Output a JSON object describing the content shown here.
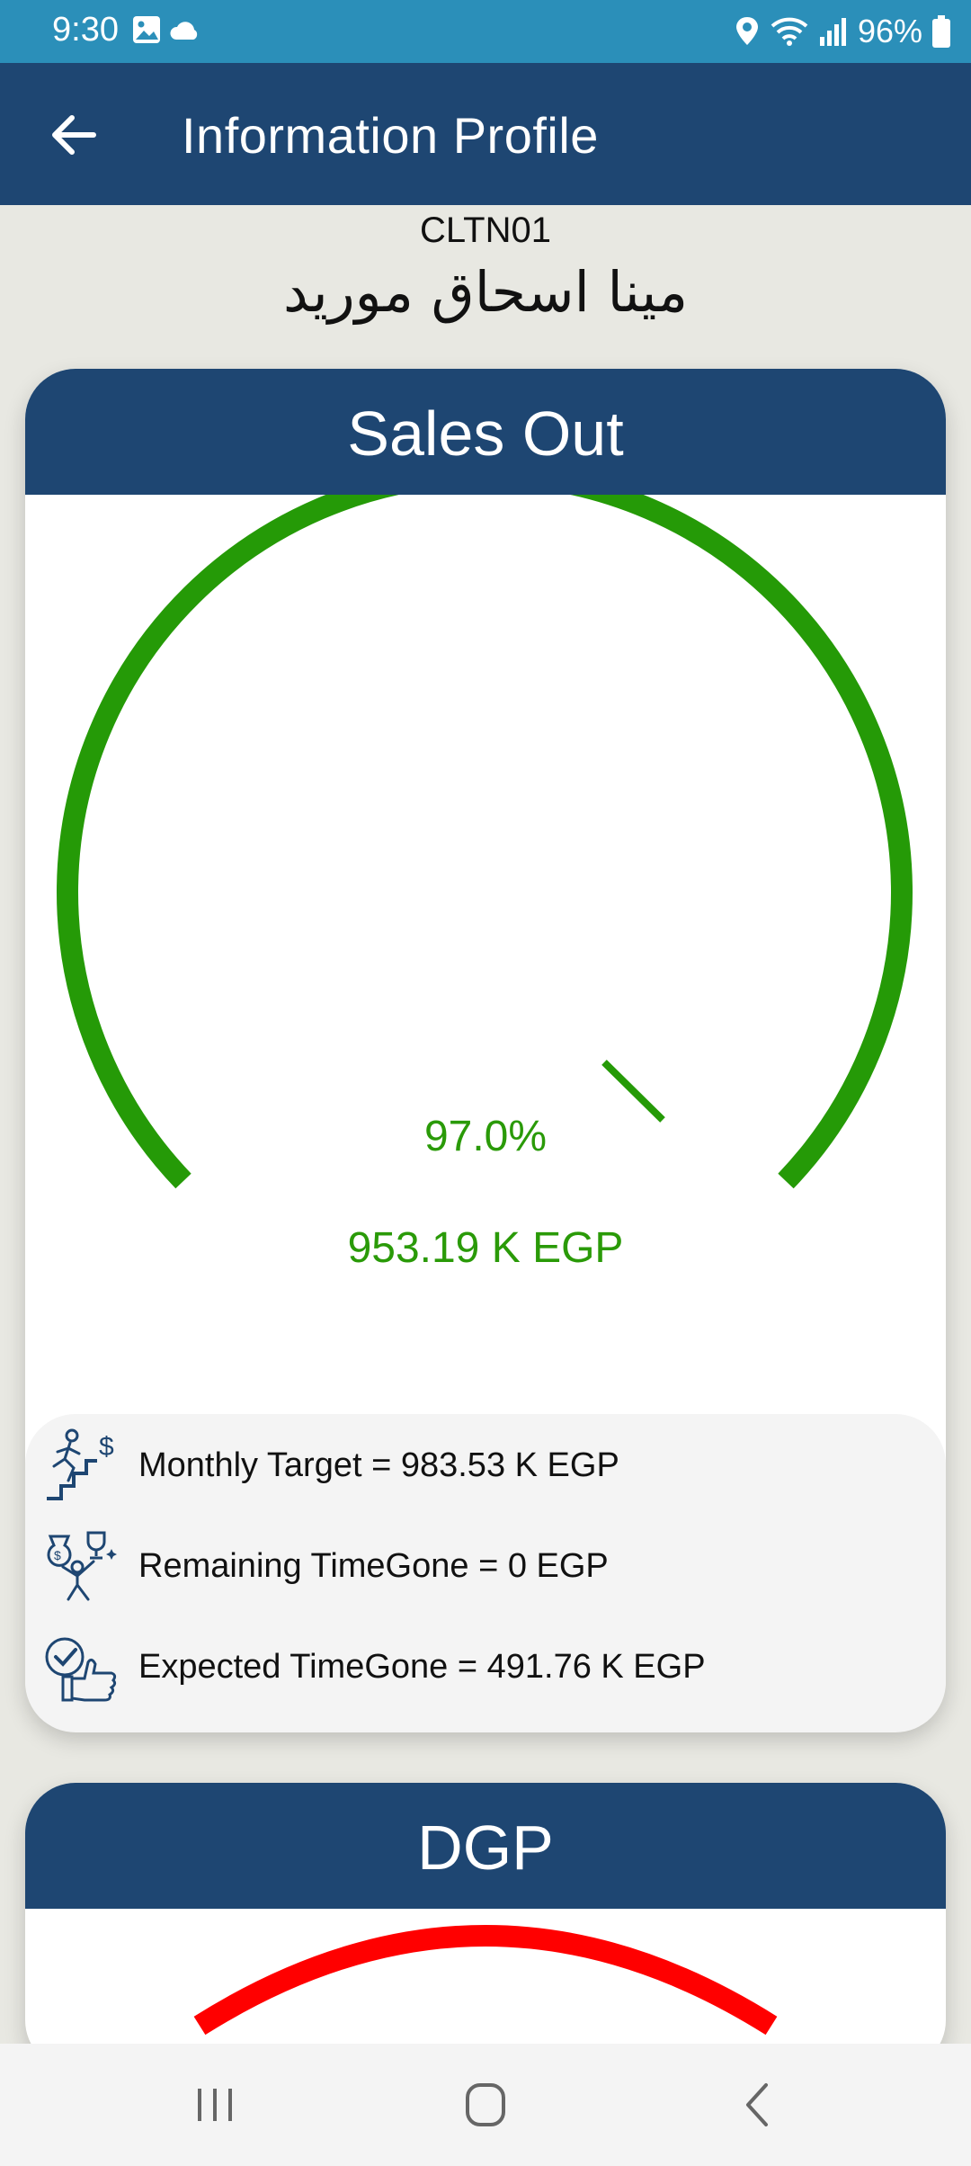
{
  "status_bar": {
    "time": "9:30",
    "battery": "96%",
    "icons": [
      "image-icon",
      "cloud-icon",
      "location-icon",
      "wifi-icon",
      "signal-icon",
      "battery-icon"
    ]
  },
  "app_bar": {
    "title": "Information Profile",
    "back_icon": "arrow-left-icon"
  },
  "client": {
    "code": "CLTN01",
    "name": "مينا اسحاق موريد"
  },
  "sales_out": {
    "title": "Sales Out",
    "percent_label": "97.0%",
    "percent_value": 97.0,
    "amount_label": "953.19 K EGP",
    "color": "#259a07",
    "rows": [
      {
        "icon": "stairs-runner-dollar-icon",
        "text": "Monthly Target = 983.53 K EGP"
      },
      {
        "icon": "money-trophy-icon",
        "text": "Remaining TimeGone = 0 EGP"
      },
      {
        "icon": "thumbs-up-check-icon",
        "text": "Expected TimeGone = 491.76 K EGP"
      }
    ]
  },
  "dgp": {
    "title": "DGP",
    "color": "#ff0000"
  },
  "colors": {
    "header": "#1e4672",
    "status_bar": "#2b8fb9",
    "background": "#e8e8e2"
  },
  "nav_bar": {
    "icons": [
      "recents-icon",
      "home-icon",
      "back-icon"
    ]
  }
}
